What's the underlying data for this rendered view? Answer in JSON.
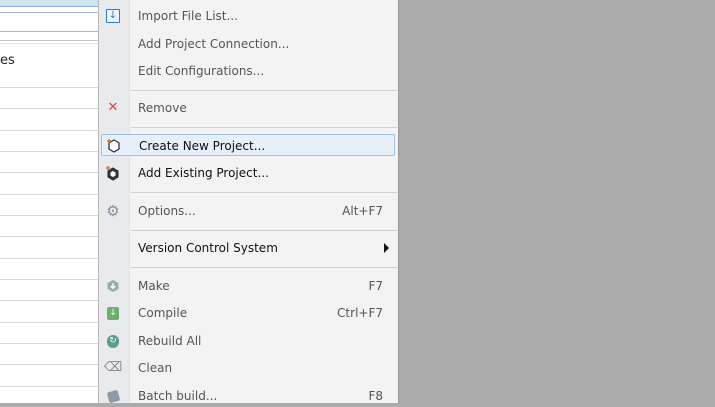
{
  "left_panel": {
    "header_fragment": "es"
  },
  "menu": {
    "items": [
      {
        "label": "Import File List...",
        "shortcut": "",
        "icon": "import-icon",
        "enabled": false
      },
      {
        "label": "Add Project Connection...",
        "shortcut": "",
        "icon": "",
        "enabled": false
      },
      {
        "label": "Edit Configurations...",
        "shortcut": "",
        "icon": "",
        "enabled": false
      },
      {
        "label": "Remove",
        "shortcut": "",
        "icon": "remove-icon",
        "enabled": false
      },
      {
        "label": "Create New Project...",
        "shortcut": "",
        "icon": "new-project-icon",
        "enabled": true
      },
      {
        "label": "Add Existing Project...",
        "shortcut": "",
        "icon": "add-project-icon",
        "enabled": true
      },
      {
        "label": "Options...",
        "shortcut": "Alt+F7",
        "icon": "gear-icon",
        "enabled": false
      },
      {
        "label": "Version Control System",
        "shortcut": "",
        "icon": "",
        "enabled": true,
        "submenu": true
      },
      {
        "label": "Make",
        "shortcut": "F7",
        "icon": "make-icon",
        "enabled": false
      },
      {
        "label": "Compile",
        "shortcut": "Ctrl+F7",
        "icon": "compile-icon",
        "enabled": false
      },
      {
        "label": "Rebuild All",
        "shortcut": "",
        "icon": "rebuild-icon",
        "enabled": false
      },
      {
        "label": "Clean",
        "shortcut": "",
        "icon": "clean-icon",
        "enabled": false
      },
      {
        "label": "Batch build...",
        "shortcut": "F8",
        "icon": "batch-build-icon",
        "enabled": false
      }
    ]
  }
}
